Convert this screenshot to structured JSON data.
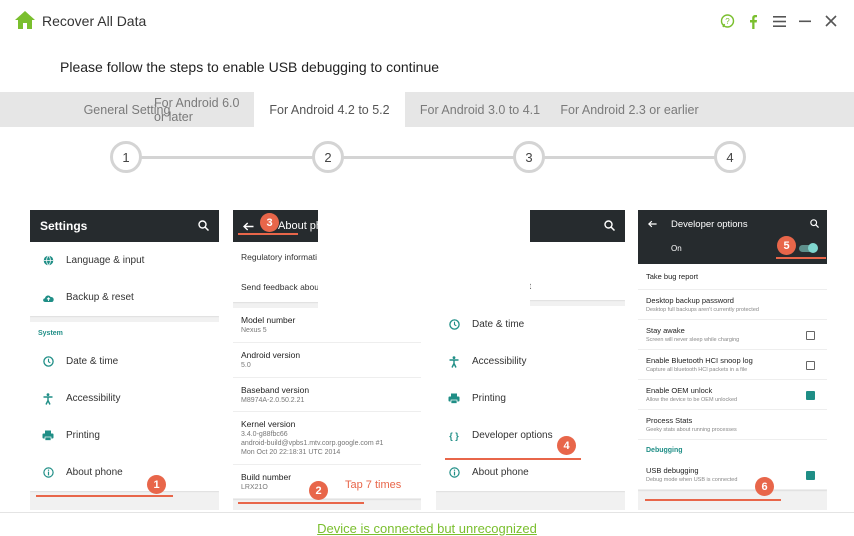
{
  "window": {
    "title": "Recover All Data",
    "icons": [
      "feedback-icon",
      "facebook-icon",
      "menu-icon",
      "minimize-icon",
      "close-icon"
    ]
  },
  "instruction": "Please follow the steps to enable USB debugging to continue",
  "tabs": [
    {
      "label": "General Setting",
      "active": false
    },
    {
      "label": "For Android 6.0 or later",
      "active": false
    },
    {
      "label": "For Android 4.2 to 5.2",
      "active": true
    },
    {
      "label": "For Android 3.0 to 4.1",
      "active": false
    },
    {
      "label": "For Android 2.3 or earlier",
      "active": false
    }
  ],
  "steps": [
    "1",
    "2",
    "3",
    "4"
  ],
  "panel1": {
    "title": "Settings",
    "items": [
      {
        "label": "Language & input",
        "icon": "globe-icon"
      },
      {
        "label": "Backup & reset",
        "icon": "cloud-upload-icon"
      }
    ],
    "section": "System",
    "system_items": [
      {
        "label": "Date & time",
        "icon": "clock-icon"
      },
      {
        "label": "Accessibility",
        "icon": "accessibility-icon"
      },
      {
        "label": "Printing",
        "icon": "printer-icon"
      },
      {
        "label": "About phone",
        "icon": "info-icon"
      }
    ],
    "badge": "1"
  },
  "panel2": {
    "title": "About pho",
    "badge_back": "3",
    "links": [
      "Regulatory informati",
      "Send feedback abou"
    ],
    "info": [
      {
        "title": "Model number",
        "sub": "Nexus 5"
      },
      {
        "title": "Android version",
        "sub": "5.0"
      },
      {
        "title": "Baseband version",
        "sub": "M8974A-2.0.50.2.21"
      },
      {
        "title": "Kernel version",
        "sub": "3.4.0-g88fbc66\nandroid-build@vpbs1.mtv.corp.google.com #1\nMon Oct 20 22:18:31 UTC 2014"
      },
      {
        "title": "Build number",
        "sub": "LRX21O"
      }
    ],
    "badge": "2",
    "tap_note": "Tap 7 times"
  },
  "panel3": {
    "partial1": ")",
    "partial2": "et",
    "items": [
      {
        "label": "Date & time",
        "icon": "clock-icon"
      },
      {
        "label": "Accessibility",
        "icon": "accessibility-icon"
      },
      {
        "label": "Printing",
        "icon": "printer-icon"
      },
      {
        "label": "Developer options",
        "icon": "braces-icon"
      },
      {
        "label": "About phone",
        "icon": "info-icon"
      }
    ],
    "badge": "4"
  },
  "panel4": {
    "title": "Developer options",
    "on_label": "On",
    "badge_toggle": "5",
    "items": [
      {
        "title": "Take bug report",
        "sub": "",
        "check": "none"
      },
      {
        "title": "Desktop backup password",
        "sub": "Desktop full backups aren't currently protected",
        "check": "none"
      },
      {
        "title": "Stay awake",
        "sub": "Screen will never sleep while charging",
        "check": "off"
      },
      {
        "title": "Enable Bluetooth HCI snoop log",
        "sub": "Capture all bluetooth HCI packets in a file",
        "check": "off"
      },
      {
        "title": "Enable OEM unlock",
        "sub": "Allow the device to be OEM unlocked",
        "check": "on"
      },
      {
        "title": "Process Stats",
        "sub": "Geeky stats about running processes",
        "check": "none"
      }
    ],
    "section": "Debugging",
    "usb": {
      "title": "USB debugging",
      "sub": "Debug mode when USB is connected"
    },
    "badge": "6"
  },
  "status": "Device is connected but unrecognized",
  "colors": {
    "accent": "#e8664a",
    "teal": "#1f8e86",
    "link": "#7abf2e",
    "appbar": "#262b2e"
  }
}
